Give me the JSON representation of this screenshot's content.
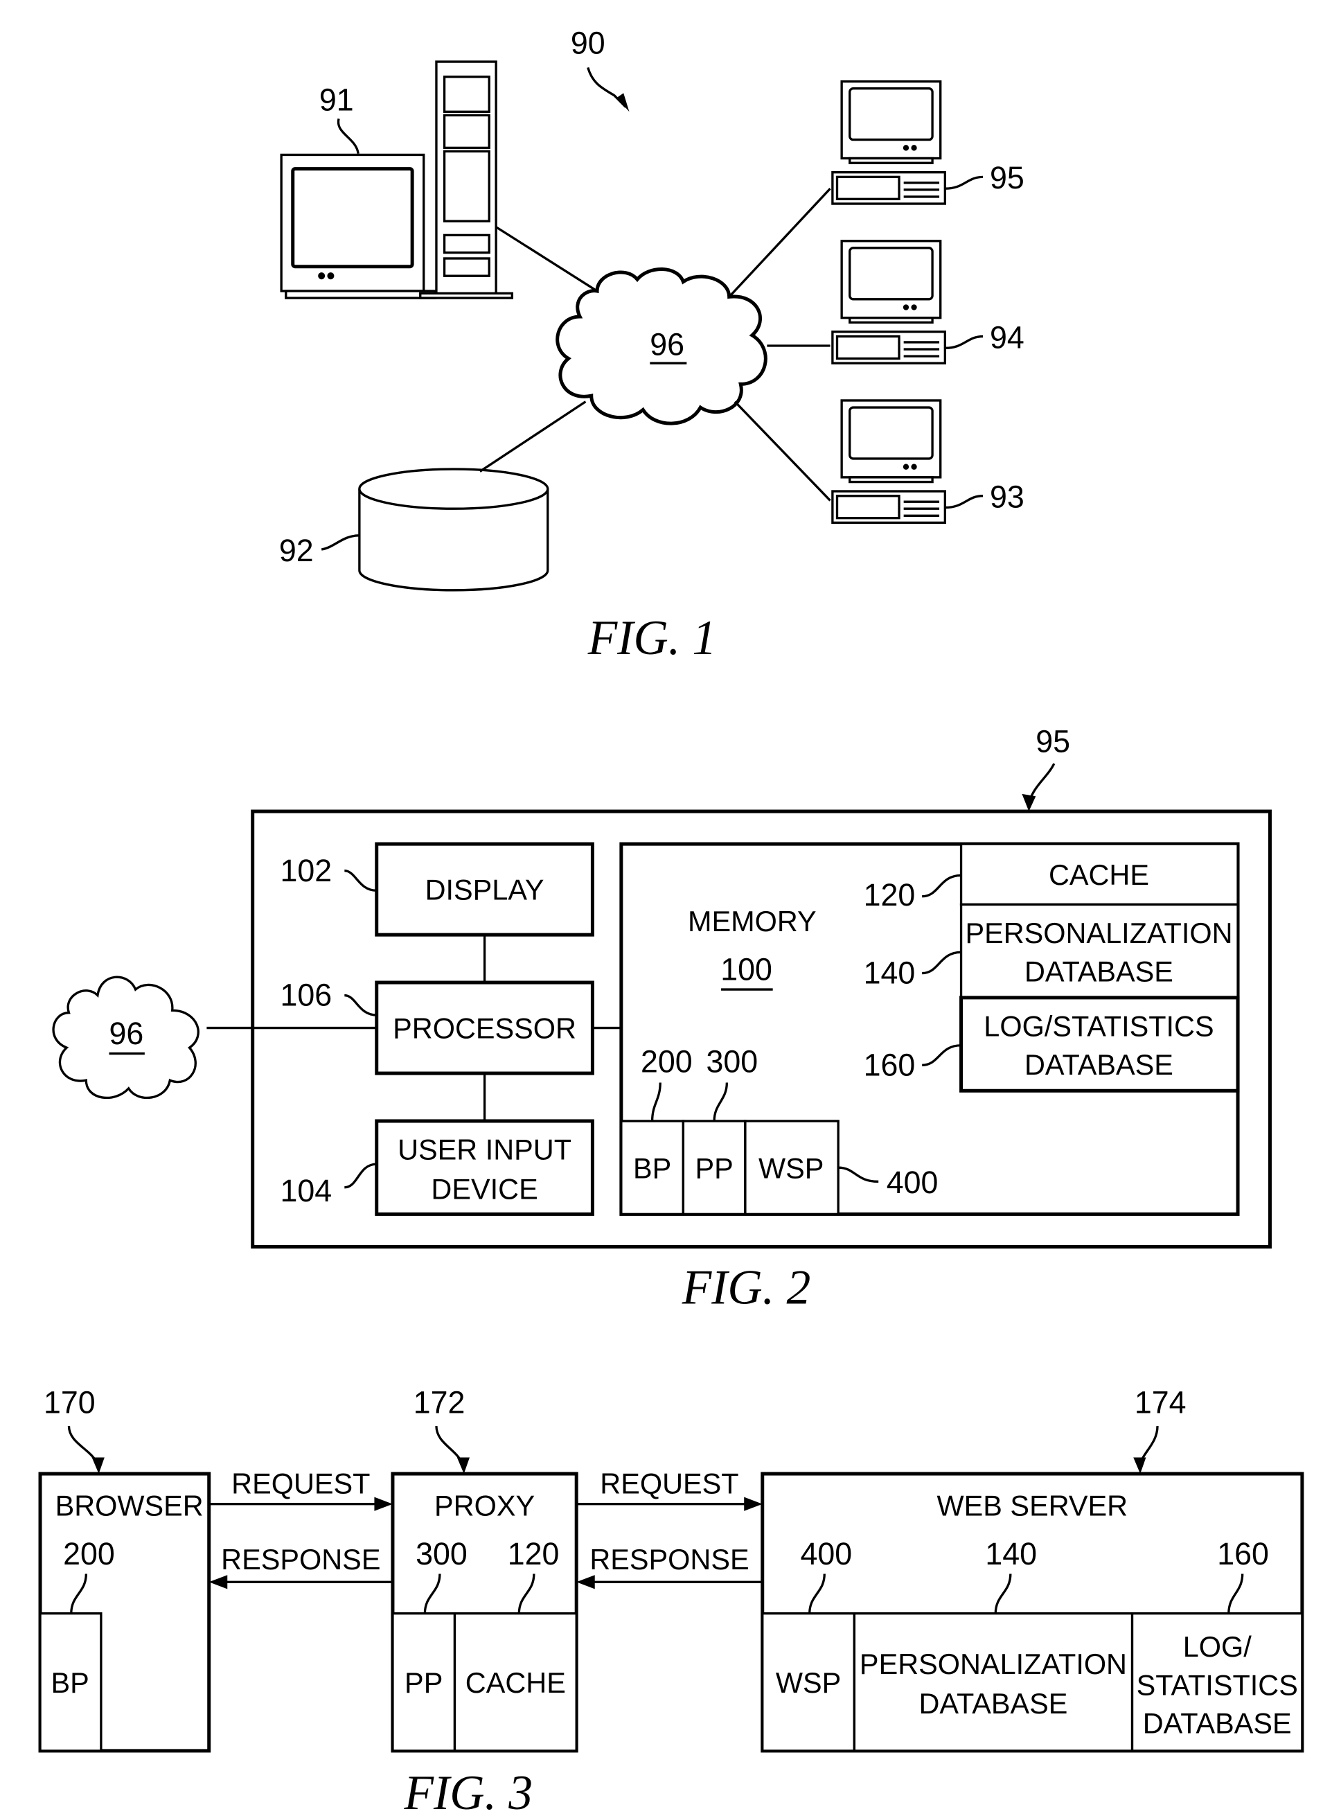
{
  "figures": {
    "fig1": {
      "caption": "FIG. 1",
      "system_ref": "90",
      "server_ref": "91",
      "storage_ref": "92",
      "network_ref": "96",
      "clients": [
        {
          "ref": "95"
        },
        {
          "ref": "94"
        },
        {
          "ref": "93"
        }
      ]
    },
    "fig2": {
      "caption": "FIG. 2",
      "device_ref": "95",
      "network_ref": "96",
      "display": {
        "label": "DISPLAY",
        "ref": "102"
      },
      "processor": {
        "label": "PROCESSOR",
        "ref": "106"
      },
      "user_input": {
        "label_line1": "USER INPUT",
        "label_line2": "DEVICE",
        "ref": "104"
      },
      "memory": {
        "label": "MEMORY",
        "ref": "100"
      },
      "cache": {
        "label": "CACHE",
        "ref": "120"
      },
      "personalization_db": {
        "label_line1": "PERSONALIZATION",
        "label_line2": "DATABASE",
        "ref": "140"
      },
      "log_db": {
        "label_line1": "LOG/STATISTICS",
        "label_line2": "DATABASE",
        "ref": "160"
      },
      "bp": {
        "label": "BP",
        "ref": "200"
      },
      "pp": {
        "label": "PP",
        "ref": "300"
      },
      "wsp": {
        "label": "WSP",
        "ref": "400"
      }
    },
    "fig3": {
      "caption": "FIG. 3",
      "browser": {
        "label": "BROWSER",
        "ref": "170",
        "bp_label": "BP",
        "bp_ref": "200"
      },
      "proxy": {
        "label": "PROXY",
        "ref": "172",
        "pp_label": "PP",
        "pp_ref": "300",
        "cache_label": "CACHE",
        "cache_ref": "120"
      },
      "web_server": {
        "label": "WEB SERVER",
        "ref": "174",
        "wsp_label": "WSP",
        "wsp_ref": "400",
        "pdb_line1": "PERSONALIZATION",
        "pdb_line2": "DATABASE",
        "pdb_ref": "140",
        "log_line1": "LOG/",
        "log_line2": "STATISTICS",
        "log_line3": "DATABASE",
        "log_ref": "160"
      },
      "arrows": {
        "request": "REQUEST",
        "response": "RESPONSE"
      }
    }
  }
}
